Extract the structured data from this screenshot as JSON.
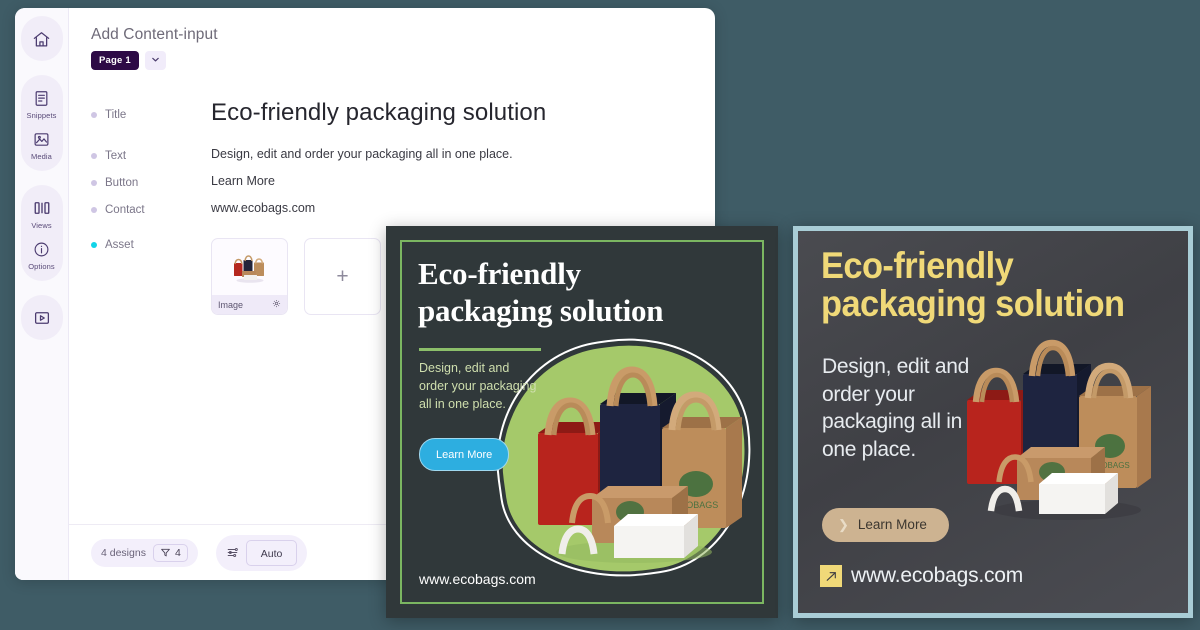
{
  "app": {
    "rail": {
      "groups": [
        {
          "items": [
            {
              "name": "home",
              "icon": "home-icon",
              "label": ""
            }
          ]
        },
        {
          "items": [
            {
              "name": "snippets",
              "icon": "snippets-icon",
              "label": "Snippets"
            },
            {
              "name": "media",
              "icon": "media-icon",
              "label": "Media"
            }
          ]
        },
        {
          "items": [
            {
              "name": "views",
              "icon": "views-icon",
              "label": "Views"
            },
            {
              "name": "options",
              "icon": "options-icon",
              "label": "Options"
            }
          ]
        },
        {
          "items": [
            {
              "name": "preview",
              "icon": "play-icon",
              "label": ""
            }
          ]
        }
      ]
    },
    "panel": {
      "title": "Add Content-input",
      "page_chip": "Page 1",
      "page_caret_icon": "chevron-down-icon",
      "fields": [
        {
          "label": "Title",
          "value": "Eco-friendly packaging solution",
          "active": false
        },
        {
          "label": "Text",
          "value": "Design, edit and order your packaging all in one place.",
          "active": false
        },
        {
          "label": "Button",
          "value": "Learn More",
          "active": false
        },
        {
          "label": "Contact",
          "value": "www.ecobags.com",
          "active": false
        },
        {
          "label": "Asset",
          "value": "",
          "active": true
        }
      ],
      "asset": {
        "thumb_label": "Image",
        "thumb_settings_icon": "gear-icon",
        "add_label": "+"
      }
    },
    "footer": {
      "designs_label": "4 designs",
      "designs_count": "4",
      "filter_icon": "filter-icon",
      "sliders_icon": "sliders-icon",
      "auto_label": "Auto"
    }
  },
  "designs": [
    {
      "id": "design-green",
      "title": "Eco-friendly packaging solution",
      "body": "Design, edit and order your packaging all in one place.",
      "button": "Learn More",
      "url": "www.ecobags.com",
      "colors": {
        "bg": "#30383a",
        "frame": "#7bb661",
        "accent": "#8cbf6a",
        "button": "#2daee0",
        "text": "#ffffff",
        "body": "#cfdfae"
      }
    },
    {
      "id": "design-slate",
      "title": "Eco-friendly packaging solution",
      "body": "Design, edit and order your packaging all in one place.",
      "button": "Learn More",
      "button_chevron": "❯",
      "url": "www.ecobags.com",
      "url_icon": "link-arrow-icon",
      "colors": {
        "bg": "#45464b",
        "frame": "#a9cdd6",
        "title": "#f0d978",
        "button": "#cdb391",
        "text": "#edf1f4"
      }
    }
  ],
  "canvas": {
    "bg": "#3f5c66"
  }
}
